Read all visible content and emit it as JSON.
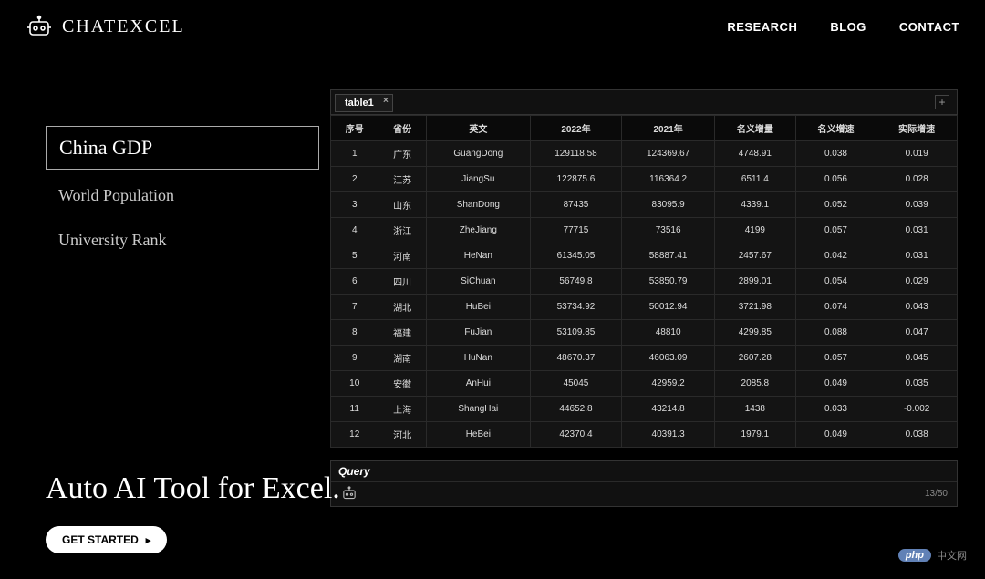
{
  "brand": "CHATEXCEL",
  "nav": {
    "research": "RESEARCH",
    "blog": "BLOG",
    "contact": "CONTACT"
  },
  "sidebar": {
    "items": [
      {
        "label": "China GDP",
        "active": true
      },
      {
        "label": "World Population",
        "active": false
      },
      {
        "label": "University Rank",
        "active": false
      }
    ]
  },
  "tab": {
    "label": "table1"
  },
  "table": {
    "headers": [
      "序号",
      "省份",
      "英文",
      "2022年",
      "2021年",
      "名义增量",
      "名义增速",
      "实际增速"
    ],
    "rows": [
      [
        "1",
        "广东",
        "GuangDong",
        "129118.58",
        "124369.67",
        "4748.91",
        "0.038",
        "0.019"
      ],
      [
        "2",
        "江苏",
        "JiangSu",
        "122875.6",
        "116364.2",
        "6511.4",
        "0.056",
        "0.028"
      ],
      [
        "3",
        "山东",
        "ShanDong",
        "87435",
        "83095.9",
        "4339.1",
        "0.052",
        "0.039"
      ],
      [
        "4",
        "浙江",
        "ZheJiang",
        "77715",
        "73516",
        "4199",
        "0.057",
        "0.031"
      ],
      [
        "5",
        "河南",
        "HeNan",
        "61345.05",
        "58887.41",
        "2457.67",
        "0.042",
        "0.031"
      ],
      [
        "6",
        "四川",
        "SiChuan",
        "56749.8",
        "53850.79",
        "2899.01",
        "0.054",
        "0.029"
      ],
      [
        "7",
        "湖北",
        "HuBei",
        "53734.92",
        "50012.94",
        "3721.98",
        "0.074",
        "0.043"
      ],
      [
        "8",
        "福建",
        "FuJian",
        "53109.85",
        "48810",
        "4299.85",
        "0.088",
        "0.047"
      ],
      [
        "9",
        "湖南",
        "HuNan",
        "48670.37",
        "46063.09",
        "2607.28",
        "0.057",
        "0.045"
      ],
      [
        "10",
        "安徽",
        "AnHui",
        "45045",
        "42959.2",
        "2085.8",
        "0.049",
        "0.035"
      ],
      [
        "11",
        "上海",
        "ShangHai",
        "44652.8",
        "43214.8",
        "1438",
        "0.033",
        "-0.002"
      ],
      [
        "12",
        "河北",
        "HeBei",
        "42370.4",
        "40391.3",
        "1979.1",
        "0.049",
        "0.038"
      ]
    ]
  },
  "query": {
    "label": "Query",
    "counter": "13/50"
  },
  "tagline": "Auto AI Tool for Excel.",
  "cta": "GET STARTED",
  "watermark": {
    "badge": "php",
    "text": "中文网"
  },
  "chart_data": {
    "type": "table",
    "title": "China GDP",
    "columns": [
      "序号",
      "省份",
      "英文",
      "2022年",
      "2021年",
      "名义增量",
      "名义增速",
      "实际增速"
    ],
    "data": [
      [
        1,
        "广东",
        "GuangDong",
        129118.58,
        124369.67,
        4748.91,
        0.038,
        0.019
      ],
      [
        2,
        "江苏",
        "JiangSu",
        122875.6,
        116364.2,
        6511.4,
        0.056,
        0.028
      ],
      [
        3,
        "山东",
        "ShanDong",
        87435,
        83095.9,
        4339.1,
        0.052,
        0.039
      ],
      [
        4,
        "浙江",
        "ZheJiang",
        77715,
        73516,
        4199,
        0.057,
        0.031
      ],
      [
        5,
        "河南",
        "HeNan",
        61345.05,
        58887.41,
        2457.67,
        0.042,
        0.031
      ],
      [
        6,
        "四川",
        "SiChuan",
        56749.8,
        53850.79,
        2899.01,
        0.054,
        0.029
      ],
      [
        7,
        "湖北",
        "HuBei",
        53734.92,
        50012.94,
        3721.98,
        0.074,
        0.043
      ],
      [
        8,
        "福建",
        "FuJian",
        53109.85,
        48810,
        4299.85,
        0.088,
        0.047
      ],
      [
        9,
        "湖南",
        "HuNan",
        48670.37,
        46063.09,
        2607.28,
        0.057,
        0.045
      ],
      [
        10,
        "安徽",
        "AnHui",
        45045,
        42959.2,
        2085.8,
        0.049,
        0.035
      ],
      [
        11,
        "上海",
        "ShangHai",
        44652.8,
        43214.8,
        1438,
        0.033,
        -0.002
      ],
      [
        12,
        "河北",
        "HeBei",
        42370.4,
        40391.3,
        1979.1,
        0.049,
        0.038
      ]
    ]
  }
}
